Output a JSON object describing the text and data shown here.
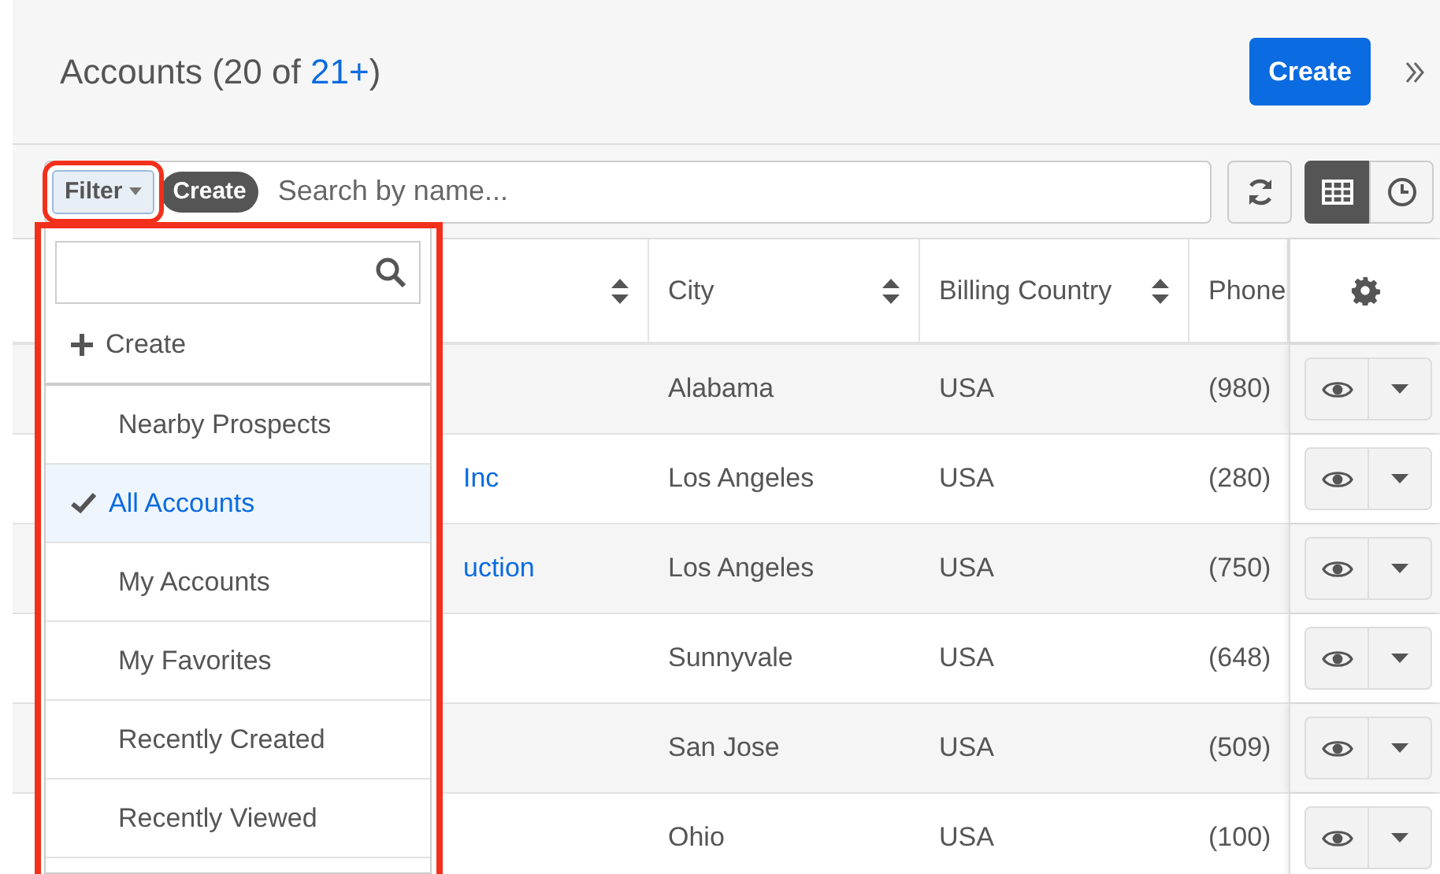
{
  "header": {
    "title": "Accounts (20 of ",
    "total": "21+",
    "title_end": ")",
    "create_button": "Create"
  },
  "toolbar": {
    "filter_button": "Filter",
    "create_pill": "Create",
    "search": {
      "placeholder": "Search by name..."
    },
    "view_toggles": [
      {
        "kind": "list",
        "selected": true
      },
      {
        "kind": "history",
        "selected": false
      }
    ]
  },
  "filter_menu": {
    "items": [
      {
        "kind": "action",
        "label": "Create",
        "selected": false
      },
      {
        "kind": "filter",
        "label": "Nearby Prospects",
        "selected": false
      },
      {
        "kind": "filter",
        "label": "All Accounts",
        "selected": true
      },
      {
        "kind": "filter",
        "label": "My Accounts",
        "selected": false
      },
      {
        "kind": "filter",
        "label": "My Favorites",
        "selected": false
      },
      {
        "kind": "filter",
        "label": "Recently Created",
        "selected": false
      },
      {
        "kind": "filter",
        "label": "Recently Viewed",
        "selected": false
      }
    ]
  },
  "table": {
    "columns": [
      {
        "sortable": true
      },
      {
        "label": "City",
        "sortable": true
      },
      {
        "label": "Billing Country",
        "sortable": true
      },
      {
        "label": "Phone"
      }
    ],
    "rows": [
      {
        "city": "Alabama",
        "country": "USA",
        "phone": "(980)"
      },
      {
        "column_1": "Inc",
        "city": "Los Angeles",
        "country": "USA",
        "phone": "(280)"
      },
      {
        "column_1": "uction",
        "city": "Los Angeles",
        "country": "USA",
        "phone": "(750)"
      },
      {
        "city": "Sunnyvale",
        "country": "USA",
        "phone": "(648)"
      },
      {
        "city": "San Jose",
        "country": "USA",
        "phone": "(509)"
      },
      {
        "city": "Ohio",
        "country": "USA",
        "phone": "(100)"
      }
    ]
  }
}
